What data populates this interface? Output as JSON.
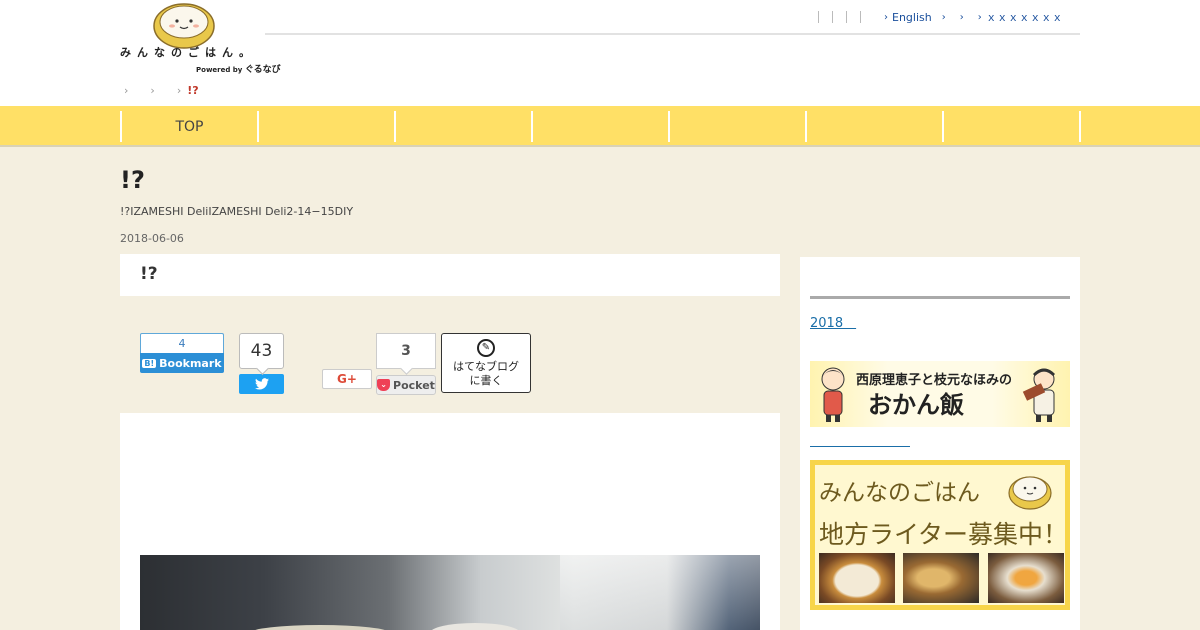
{
  "header": {
    "logo_text": "みんなのごはん。",
    "powered_by": "Powered by",
    "powered_brand": "ぐるなび",
    "top_nav": [
      {
        "label": "English"
      },
      {
        "label": ""
      },
      {
        "label": ""
      },
      {
        "label": "ｘｘｘｘｘｘｘ"
      }
    ]
  },
  "breadcrumb": {
    "current": "!?"
  },
  "global_nav": {
    "items": [
      "TOP",
      "",
      "",
      "",
      "",
      "",
      ""
    ]
  },
  "article": {
    "title": "!?",
    "subtitle": "!?IZAMESHI DeliIZAMESHI Deli2-14−15DIY",
    "date": "2018-06-06",
    "heading": "!?"
  },
  "share": {
    "hatena_count": "4",
    "hatena_label": "Bookmark",
    "twitter_count": "43",
    "gplus_label": "G+",
    "pocket_count": "3",
    "pocket_label": "Pocket",
    "hatena_blog_line1": "はてなブログ",
    "hatena_blog_line2": "に書く"
  },
  "sidebar": {
    "link_2018": "2018　",
    "okan_title_top": "西原理恵子と枝元なほみの",
    "okan_title_main": "おかん飯",
    "writer_line1": "みんなのごはん",
    "writer_line2": "地方ライター募集中！"
  },
  "colors": {
    "nav_yellow": "#ffe066",
    "page_bg": "#f4efe0",
    "link_blue": "#1a4f9c",
    "twitter_blue": "#1da1f2",
    "pocket_red": "#ef4056"
  }
}
